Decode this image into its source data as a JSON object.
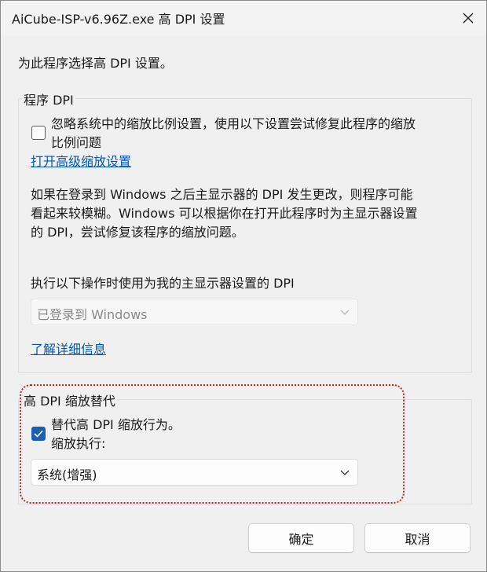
{
  "window": {
    "title": "AiCube-ISP-v6.96Z.exe 高 DPI 设置"
  },
  "intro_text": "为此程序选择高 DPI 设置。",
  "program_dpi": {
    "group_label": "程序 DPI",
    "override_checkbox_label_line1": "忽略系统中的缩放比例设置，使用以下设置尝试修复此程序的缩放",
    "override_checkbox_label_line2": "比例问题",
    "override_checked": false,
    "advanced_link": "打开高级缩放设置",
    "description_line1": "如果在登录到 Windows 之后主显示器的 DPI 发生更改，则程序可能",
    "description_line2": "看起来较模糊。Windows 可以根据你在打开此程序时为主显示器设置",
    "description_line3": "的 DPI，尝试修复该程序的缩放问题。",
    "use_dpi_label": "执行以下操作时使用为我的主显示器设置的 DPI",
    "use_dpi_value": "已登录到 Windows",
    "learn_more_link": "了解详细信息"
  },
  "high_dpi_override": {
    "group_label": "高 DPI 缩放替代",
    "checkbox_label": "替代高 DPI 缩放行为。",
    "checked": true,
    "scaling_label": "缩放执行:",
    "scaling_value": "系统(增强)"
  },
  "buttons": {
    "ok": "确定",
    "cancel": "取消"
  },
  "colors": {
    "accent": "#1a5fb4",
    "link": "#0058b8",
    "highlight": "#d01f1f"
  }
}
